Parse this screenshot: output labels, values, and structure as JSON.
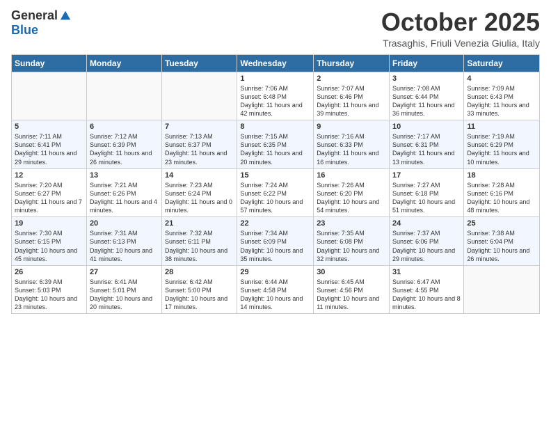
{
  "logo": {
    "general": "General",
    "blue": "Blue"
  },
  "title": "October 2025",
  "subtitle": "Trasaghis, Friuli Venezia Giulia, Italy",
  "weekdays": [
    "Sunday",
    "Monday",
    "Tuesday",
    "Wednesday",
    "Thursday",
    "Friday",
    "Saturday"
  ],
  "weeks": [
    [
      {
        "day": "",
        "info": ""
      },
      {
        "day": "",
        "info": ""
      },
      {
        "day": "",
        "info": ""
      },
      {
        "day": "1",
        "info": "Sunrise: 7:06 AM\nSunset: 6:48 PM\nDaylight: 11 hours and 42 minutes."
      },
      {
        "day": "2",
        "info": "Sunrise: 7:07 AM\nSunset: 6:46 PM\nDaylight: 11 hours and 39 minutes."
      },
      {
        "day": "3",
        "info": "Sunrise: 7:08 AM\nSunset: 6:44 PM\nDaylight: 11 hours and 36 minutes."
      },
      {
        "day": "4",
        "info": "Sunrise: 7:09 AM\nSunset: 6:43 PM\nDaylight: 11 hours and 33 minutes."
      }
    ],
    [
      {
        "day": "5",
        "info": "Sunrise: 7:11 AM\nSunset: 6:41 PM\nDaylight: 11 hours and 29 minutes."
      },
      {
        "day": "6",
        "info": "Sunrise: 7:12 AM\nSunset: 6:39 PM\nDaylight: 11 hours and 26 minutes."
      },
      {
        "day": "7",
        "info": "Sunrise: 7:13 AM\nSunset: 6:37 PM\nDaylight: 11 hours and 23 minutes."
      },
      {
        "day": "8",
        "info": "Sunrise: 7:15 AM\nSunset: 6:35 PM\nDaylight: 11 hours and 20 minutes."
      },
      {
        "day": "9",
        "info": "Sunrise: 7:16 AM\nSunset: 6:33 PM\nDaylight: 11 hours and 16 minutes."
      },
      {
        "day": "10",
        "info": "Sunrise: 7:17 AM\nSunset: 6:31 PM\nDaylight: 11 hours and 13 minutes."
      },
      {
        "day": "11",
        "info": "Sunrise: 7:19 AM\nSunset: 6:29 PM\nDaylight: 11 hours and 10 minutes."
      }
    ],
    [
      {
        "day": "12",
        "info": "Sunrise: 7:20 AM\nSunset: 6:27 PM\nDaylight: 11 hours and 7 minutes."
      },
      {
        "day": "13",
        "info": "Sunrise: 7:21 AM\nSunset: 6:26 PM\nDaylight: 11 hours and 4 minutes."
      },
      {
        "day": "14",
        "info": "Sunrise: 7:23 AM\nSunset: 6:24 PM\nDaylight: 11 hours and 0 minutes."
      },
      {
        "day": "15",
        "info": "Sunrise: 7:24 AM\nSunset: 6:22 PM\nDaylight: 10 hours and 57 minutes."
      },
      {
        "day": "16",
        "info": "Sunrise: 7:26 AM\nSunset: 6:20 PM\nDaylight: 10 hours and 54 minutes."
      },
      {
        "day": "17",
        "info": "Sunrise: 7:27 AM\nSunset: 6:18 PM\nDaylight: 10 hours and 51 minutes."
      },
      {
        "day": "18",
        "info": "Sunrise: 7:28 AM\nSunset: 6:16 PM\nDaylight: 10 hours and 48 minutes."
      }
    ],
    [
      {
        "day": "19",
        "info": "Sunrise: 7:30 AM\nSunset: 6:15 PM\nDaylight: 10 hours and 45 minutes."
      },
      {
        "day": "20",
        "info": "Sunrise: 7:31 AM\nSunset: 6:13 PM\nDaylight: 10 hours and 41 minutes."
      },
      {
        "day": "21",
        "info": "Sunrise: 7:32 AM\nSunset: 6:11 PM\nDaylight: 10 hours and 38 minutes."
      },
      {
        "day": "22",
        "info": "Sunrise: 7:34 AM\nSunset: 6:09 PM\nDaylight: 10 hours and 35 minutes."
      },
      {
        "day": "23",
        "info": "Sunrise: 7:35 AM\nSunset: 6:08 PM\nDaylight: 10 hours and 32 minutes."
      },
      {
        "day": "24",
        "info": "Sunrise: 7:37 AM\nSunset: 6:06 PM\nDaylight: 10 hours and 29 minutes."
      },
      {
        "day": "25",
        "info": "Sunrise: 7:38 AM\nSunset: 6:04 PM\nDaylight: 10 hours and 26 minutes."
      }
    ],
    [
      {
        "day": "26",
        "info": "Sunrise: 6:39 AM\nSunset: 5:03 PM\nDaylight: 10 hours and 23 minutes."
      },
      {
        "day": "27",
        "info": "Sunrise: 6:41 AM\nSunset: 5:01 PM\nDaylight: 10 hours and 20 minutes."
      },
      {
        "day": "28",
        "info": "Sunrise: 6:42 AM\nSunset: 5:00 PM\nDaylight: 10 hours and 17 minutes."
      },
      {
        "day": "29",
        "info": "Sunrise: 6:44 AM\nSunset: 4:58 PM\nDaylight: 10 hours and 14 minutes."
      },
      {
        "day": "30",
        "info": "Sunrise: 6:45 AM\nSunset: 4:56 PM\nDaylight: 10 hours and 11 minutes."
      },
      {
        "day": "31",
        "info": "Sunrise: 6:47 AM\nSunset: 4:55 PM\nDaylight: 10 hours and 8 minutes."
      },
      {
        "day": "",
        "info": ""
      }
    ]
  ]
}
